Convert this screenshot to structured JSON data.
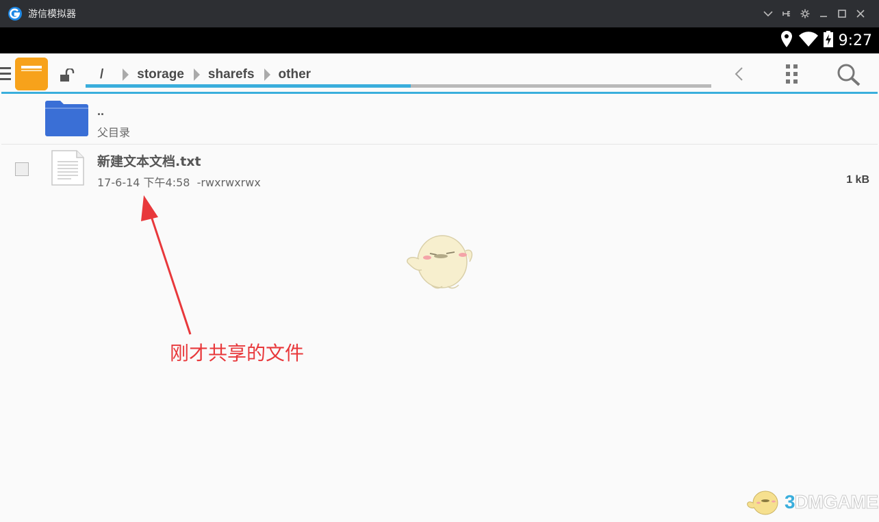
{
  "window": {
    "title": "游信模拟器"
  },
  "status_bar": {
    "time": "9:27"
  },
  "toolbar": {
    "path": [
      {
        "label": "/"
      },
      {
        "label": "storage"
      },
      {
        "label": "sharefs"
      },
      {
        "label": "other"
      }
    ],
    "path_progress": 0.52
  },
  "list": {
    "parent": {
      "name": "..",
      "subtitle": "父目录"
    },
    "files": [
      {
        "name": "新建文本文档.txt",
        "date": "17-6-14 下午4:58",
        "permissions": "-rwxrwxrwx",
        "size": "1 kB"
      }
    ]
  },
  "annotation": {
    "text": "刚才共享的文件",
    "color": "#e8383b"
  },
  "watermark": {
    "prefix": "3",
    "text": "DMGAME"
  },
  "colors": {
    "accent": "#3aaedc",
    "folder": "#3a6fd6",
    "app_icon": "#f7a21b",
    "titlebar": "#2d2f33"
  }
}
